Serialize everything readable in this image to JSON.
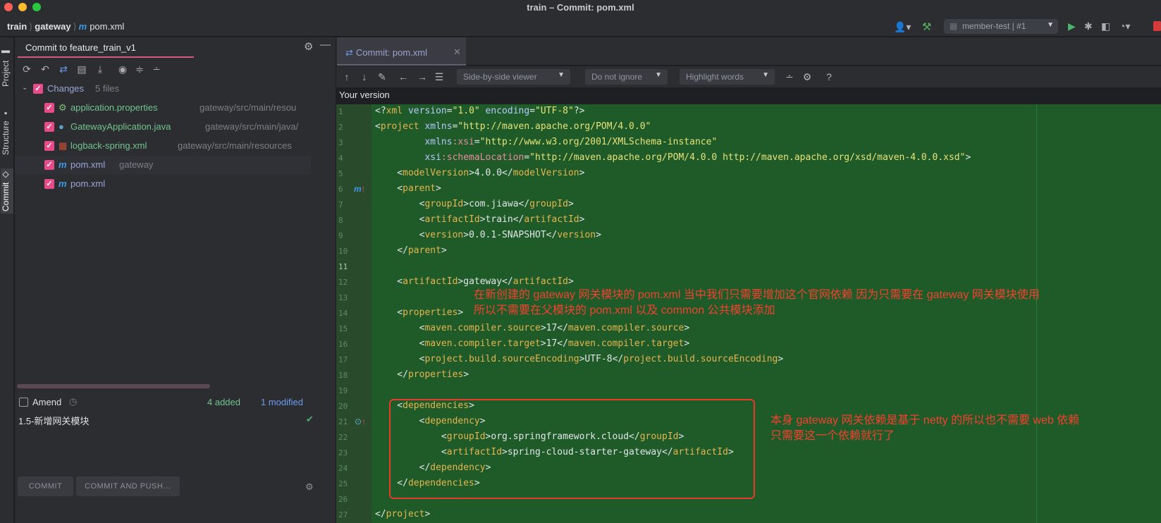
{
  "window": {
    "title": "train – Commit: pom.xml"
  },
  "breadcrumbs": {
    "project": "train",
    "module": "gateway",
    "file": "pom.xml"
  },
  "run_config": {
    "label": "member-test | #1"
  },
  "tool_windows": {
    "project": "Project",
    "structure": "Structure",
    "commit": "Commit"
  },
  "commit_panel": {
    "title": "Commit to feature_train_v1",
    "changes_label": "Changes",
    "changes_count": "5 files",
    "files": [
      {
        "name": "application.properties",
        "path": "gateway/src/main/resou"
      },
      {
        "name": "GatewayApplication.java",
        "path": "gateway/src/main/java/"
      },
      {
        "name": "logback-spring.xml",
        "path": "gateway/src/main/resources"
      },
      {
        "name": "pom.xml",
        "path": "gateway"
      },
      {
        "name": "pom.xml",
        "path": ""
      }
    ],
    "amend_label": "Amend",
    "added": "4 added",
    "modified": "1 modified",
    "message": "1.5-新增网关模块",
    "commit_button": "COMMIT",
    "commit_push_button": "COMMIT AND PUSH…"
  },
  "editor": {
    "tab_label": "Commit: pom.xml",
    "viewer_mode": "Side-by-side viewer",
    "ignore_mode": "Do not ignore",
    "highlight_mode": "Highlight words",
    "pane_title": "Your version",
    "line_numbers": [
      "1",
      "2",
      "3",
      "4",
      "5",
      "6",
      "7",
      "8",
      "9",
      "10",
      "11",
      "12",
      "13",
      "14",
      "15",
      "16",
      "17",
      "18",
      "19",
      "20",
      "21",
      "22",
      "23",
      "24",
      "25",
      "26",
      "27"
    ]
  },
  "annotations": {
    "note1_line1": "在新创建的 gateway 网关模块的 pom.xml 当中我们只需要增加这个官网依赖 因为只需要在 gateway 网关模块使用",
    "note1_line2": "所以不需要在父模块的 pom.xml 以及 common 公共模块添加",
    "note2_line1": "本身 gateway 网关依赖是基于 netty 的所以也不需要 web 依赖",
    "note2_line2": "只需要这一个依赖就行了"
  },
  "code": {
    "l1": {
      "a": "<?",
      "b": "xml ",
      "c": "version",
      "d": "=",
      "e": "\"1.0\"",
      "f": " encoding",
      "g": "=",
      "h": "\"UTF-8\"",
      "i": "?>"
    },
    "l2": {
      "a": "<",
      "b": "project ",
      "c": "xmlns",
      "d": "=",
      "e": "\"http://maven.apache.org/POM/4.0.0\""
    },
    "l3": {
      "a": "         xmlns",
      "b": ":xsi",
      "c": "=",
      "d": "\"http://www.w3.org/2001/XMLSchema-instance\""
    },
    "l4": {
      "a": "         xsi",
      "b": ":schemaLocation",
      "c": "=",
      "d": "\"http://maven.apache.org/POM/4.0.0 http://maven.apache.org/xsd/maven-4.0.0.xsd\"",
      "e": ">"
    },
    "l5": {
      "a": "    <",
      "b": "modelVersion",
      "c": ">4.0.0</",
      "d": "modelVersion",
      "e": ">"
    },
    "l6": {
      "a": "    <",
      "b": "parent",
      "c": ">"
    },
    "l7": {
      "a": "        <",
      "b": "groupId",
      "c": ">com.jiawa</",
      "d": "groupId",
      "e": ">"
    },
    "l8": {
      "a": "        <",
      "b": "artifactId",
      "c": ">train</",
      "d": "artifactId",
      "e": ">"
    },
    "l9": {
      "a": "        <",
      "b": "version",
      "c": ">0.0.1-SNAPSHOT</",
      "d": "version",
      "e": ">"
    },
    "l10": {
      "a": "    </",
      "b": "parent",
      "c": ">"
    },
    "l12": {
      "a": "    <",
      "b": "artifactId",
      "c": ">gateway</",
      "d": "artifactId",
      "e": ">"
    },
    "l14": {
      "a": "    <",
      "b": "properties",
      "c": ">"
    },
    "l15": {
      "a": "        <",
      "b": "maven.compiler.source",
      "c": ">17</",
      "d": "maven.compiler.source",
      "e": ">"
    },
    "l16": {
      "a": "        <",
      "b": "maven.compiler.target",
      "c": ">17</",
      "d": "maven.compiler.target",
      "e": ">"
    },
    "l17": {
      "a": "        <",
      "b": "project.build.sourceEncoding",
      "c": ">UTF-8</",
      "d": "project.build.sourceEncoding",
      "e": ">"
    },
    "l18": {
      "a": "    </",
      "b": "properties",
      "c": ">"
    },
    "l20": {
      "a": "    <",
      "b": "dependencies",
      "c": ">"
    },
    "l21": {
      "a": "        <",
      "b": "dependency",
      "c": ">"
    },
    "l22": {
      "a": "            <",
      "b": "groupId",
      "c": ">org.springframework.cloud</",
      "d": "groupId",
      "e": ">"
    },
    "l23": {
      "a": "            <",
      "b": "artifactId",
      "c": ">spring-cloud-starter-gateway</",
      "d": "artifactId",
      "e": ">"
    },
    "l24": {
      "a": "        </",
      "b": "dependency",
      "c": ">"
    },
    "l25": {
      "a": "    </",
      "b": "dependencies",
      "c": ">"
    },
    "l27": {
      "a": "</",
      "b": "project",
      "c": ">"
    }
  }
}
